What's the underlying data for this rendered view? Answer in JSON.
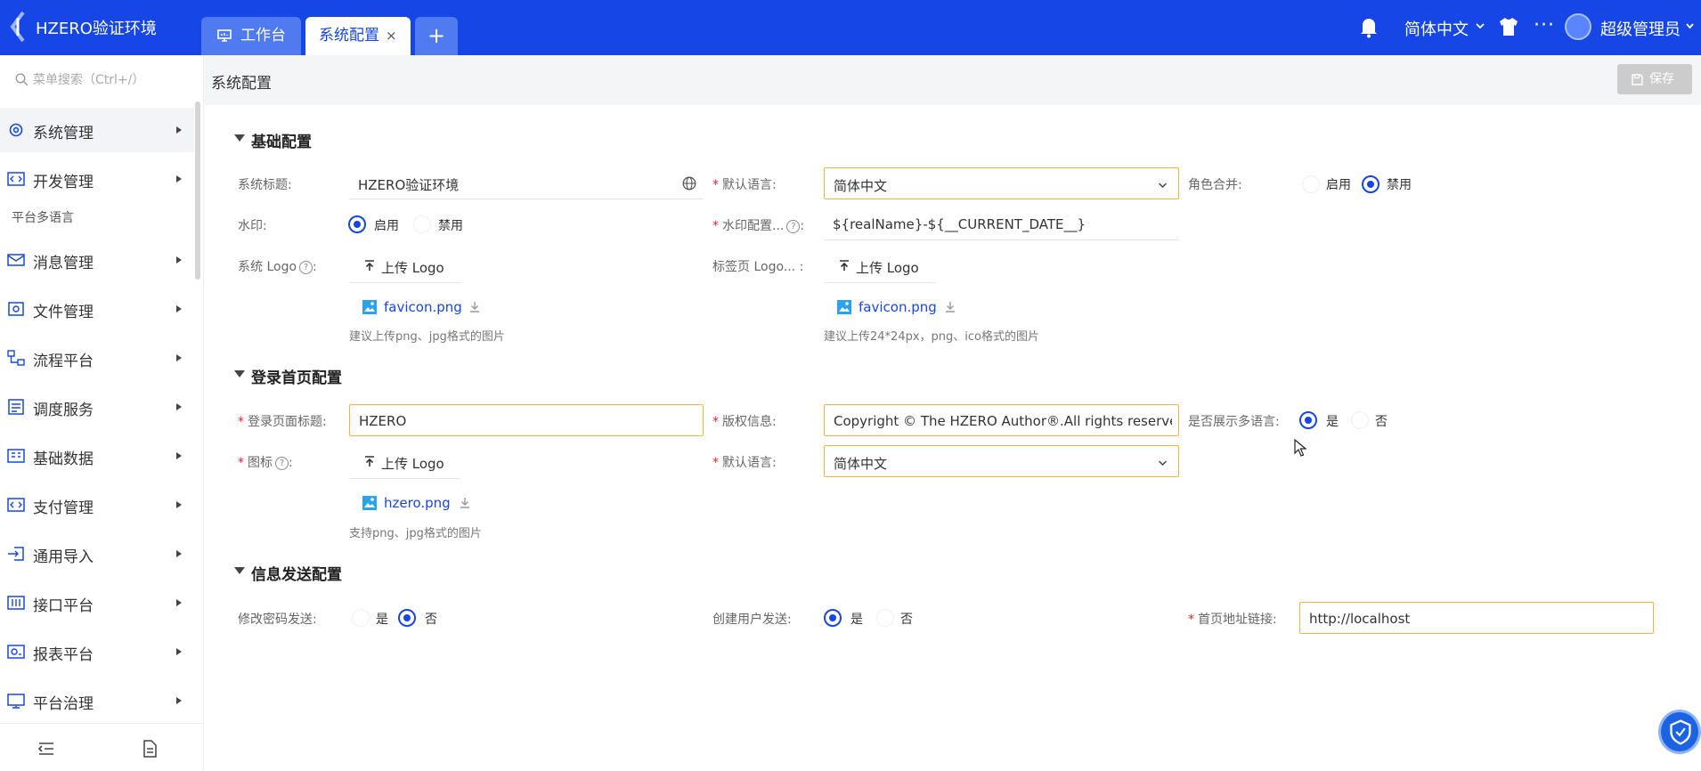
{
  "app": {
    "title": "HZERO验证环境"
  },
  "tabs": [
    {
      "label": "工作台"
    },
    {
      "label": "系统配置",
      "close": "×"
    },
    {
      "label": "+"
    }
  ],
  "header": {
    "language": "简体中文",
    "more": "···",
    "user": "超级管理员"
  },
  "sidebar": {
    "search_placeholder": "菜单搜索（Ctrl+/）",
    "items": [
      {
        "label": "系统管理"
      },
      {
        "label": "开发管理"
      },
      {
        "label": "消息管理"
      },
      {
        "label": "文件管理"
      },
      {
        "label": "流程平台"
      },
      {
        "label": "调度服务"
      },
      {
        "label": "基础数据"
      },
      {
        "label": "支付管理"
      },
      {
        "label": "通用导入"
      },
      {
        "label": "接口平台"
      },
      {
        "label": "报表平台"
      },
      {
        "label": "平台治理"
      }
    ],
    "submenu": "平台多语言"
  },
  "page": {
    "title": "系统配置",
    "save": "保存"
  },
  "basic": {
    "title": "基础配置",
    "sys_title_label": "系统标题:",
    "sys_title_value": "HZERO验证环境",
    "default_lang_label": "默认语言:",
    "default_lang_value": "简体中文",
    "role_merge_label": "角色合并:",
    "enable": "启用",
    "disable": "禁用",
    "watermark_label": "水印:",
    "watermark_config_label": "水印配置...",
    "watermark_config_value": "${realName}-${__CURRENT_DATE__}",
    "sys_logo_label": "系统 Logo",
    "upload_logo": "上传 Logo",
    "tab_logo_label": "标签页 Logo...",
    "favicon": "favicon.png",
    "hint_logo": "建议上传png、jpg格式的图片",
    "hint_tab_logo": "建议上传24*24px，png、ico格式的图片"
  },
  "login": {
    "title": "登录首页配置",
    "page_title_label": "登录页面标题:",
    "page_title_value": "HZERO",
    "copyright_label": "版权信息:",
    "copyright_value": "Copyright © The HZERO Author®.All rights reserved",
    "show_lang_label": "是否展示多语言:",
    "yes": "是",
    "no": "否",
    "icon_label": "图标",
    "upload_logo": "上传 Logo",
    "default_lang_label": "默认语言:",
    "default_lang_value": "简体中文",
    "icon_file": "hzero.png",
    "hint_icon": "支持png、jpg格式的图片"
  },
  "message": {
    "title": "信息发送配置",
    "pwd_label": "修改密码发送:",
    "user_label": "创建用户发送:",
    "yes": "是",
    "no": "否",
    "home_link_label": "首页地址链接:",
    "home_link_value": "http://localhost"
  },
  "colors": {
    "brand": "#1646e6",
    "focus_border": "#f3b53f",
    "required": "#f5222d"
  }
}
